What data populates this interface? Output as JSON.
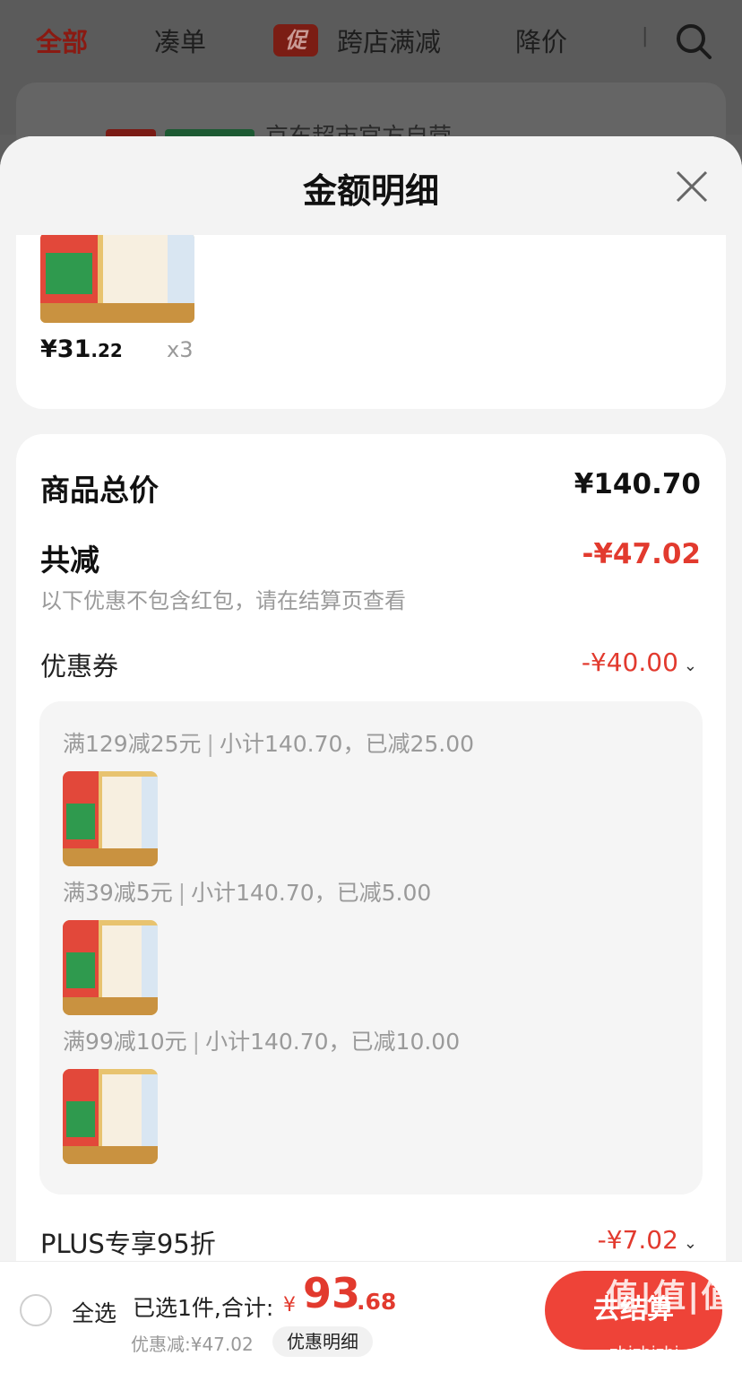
{
  "tabs": {
    "all": "全部",
    "bundle": "凑单",
    "promo_badge": "促",
    "cross_store": "跨店满减",
    "price_drop": "降价"
  },
  "behind_card": {
    "title": "京东超市官方自营"
  },
  "sheet": {
    "title": "金额明细",
    "product": {
      "price_int": "¥31",
      "price_dec": ".22",
      "qty": "x3"
    },
    "summary": {
      "total_label": "商品总价",
      "total_value": "¥140.70",
      "reduce_label": "共减",
      "reduce_value": "-¥47.02",
      "note": "以下优惠不包含红包，请在结算页查看",
      "coupon_label": "优惠券",
      "coupon_value": "-¥40.00",
      "coupon_rules": [
        {
          "rule": "满129减25元",
          "detail": "小计140.70，已减25.00"
        },
        {
          "rule": "满39减5元",
          "detail": "小计140.70，已减5.00"
        },
        {
          "rule": "满99减10元",
          "detail": "小计140.70，已减10.00"
        }
      ],
      "plus_label": "PLUS专享95折",
      "plus_value": "-¥7.02"
    }
  },
  "bottom_bar": {
    "select_all": "全选",
    "selected_info": "已选1件,合计:",
    "total_yen": "¥",
    "total_int": "93",
    "total_dec": ".68",
    "reduced_text": "优惠减:¥47.02",
    "detail_button": "优惠明细",
    "checkout_button": "去结算"
  },
  "watermark": {
    "main": "值|值|值",
    "sub": "zhizhizhi.com"
  },
  "colors": {
    "accent_red": "#e23a2e",
    "checkout_bg": "#ee4338",
    "sheet_bg": "#f3f3f3"
  },
  "icons": [
    "search-icon",
    "close-icon",
    "chevron-down-icon",
    "radio-icon"
  ]
}
